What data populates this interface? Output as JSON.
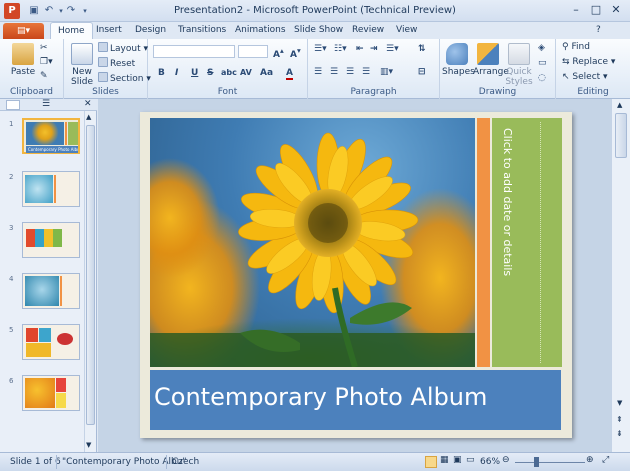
{
  "window": {
    "title": "Presentation2 - Microsoft PowerPoint (Technical Preview)",
    "app_icon_glyph": "P",
    "minimize": "–",
    "maximize": "□",
    "close": "✕"
  },
  "ribbon": {
    "file_tab": "",
    "tabs": [
      "Home",
      "Insert",
      "Design",
      "Transitions",
      "Animations",
      "Slide Show",
      "Review",
      "View"
    ],
    "active_tab": "Home",
    "groups": {
      "clipboard": {
        "label": "Clipboard",
        "paste": "Paste"
      },
      "slides": {
        "label": "Slides",
        "new_slide": "New Slide",
        "layout": "Layout",
        "reset": "Reset",
        "section": "Section"
      },
      "font": {
        "label": "Font",
        "bold": "B",
        "italic": "I",
        "underline": "U",
        "strike": "S",
        "shadow": "abc",
        "spacing": "AV",
        "case": "Aa",
        "color": "A"
      },
      "paragraph": {
        "label": "Paragraph"
      },
      "drawing": {
        "label": "Drawing",
        "shapes": "Shapes",
        "arrange": "Arrange",
        "quick_styles": "Quick Styles"
      },
      "editing": {
        "label": "Editing",
        "find": "Find",
        "replace": "Replace",
        "select": "Select"
      }
    }
  },
  "slides_pane": {
    "thumbnails": [
      {
        "number": "1",
        "caption": "Contemporary Photo Album"
      },
      {
        "number": "2",
        "caption": ""
      },
      {
        "number": "3",
        "caption": ""
      },
      {
        "number": "4",
        "caption": ""
      },
      {
        "number": "5",
        "caption": ""
      },
      {
        "number": "6",
        "caption": ""
      }
    ]
  },
  "slide": {
    "title": "Contemporary Photo Album",
    "date_placeholder": "Click to add date or details",
    "colors": {
      "orange": "#f19244",
      "green": "#99bb5a",
      "blue": "#4c81bd"
    }
  },
  "status_bar": {
    "slide_indicator": "Slide 1 of 6",
    "theme": "\"Contemporary Photo Albu\"",
    "language": "Czech",
    "zoom": "66%"
  }
}
